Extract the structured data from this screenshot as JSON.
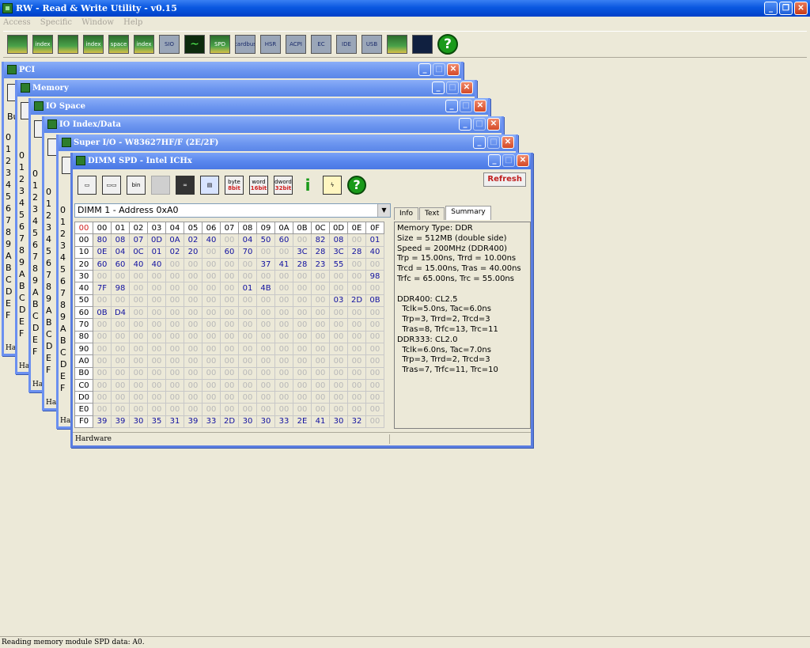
{
  "app": {
    "title": "RW - Read & Write Utility - v0.15"
  },
  "menu": [
    "Access",
    "Specific",
    "Window",
    "Help"
  ],
  "toolbar": [
    {
      "name": "pci-icon",
      "label": ""
    },
    {
      "name": "index-icon",
      "label": "index"
    },
    {
      "name": "memory-icon",
      "label": ""
    },
    {
      "name": "index-space-icon",
      "label": "index"
    },
    {
      "name": "io-space-icon",
      "label": "space"
    },
    {
      "name": "io-index-icon",
      "label": "index"
    },
    {
      "name": "sio-icon",
      "label": "SIO"
    },
    {
      "name": "waveform-icon",
      "label": "~"
    },
    {
      "name": "spd-icon",
      "label": "SPD"
    },
    {
      "name": "cardbus-icon",
      "label": "cardbus"
    },
    {
      "name": "hsr-icon",
      "label": "HSR"
    },
    {
      "name": "acpi-icon",
      "label": "ACPI"
    },
    {
      "name": "ec-icon",
      "label": "EC"
    },
    {
      "name": "ide-icon",
      "label": "IDE"
    },
    {
      "name": "usb-icon",
      "label": "USB"
    },
    {
      "name": "smbus-icon",
      "label": ""
    },
    {
      "name": "command-icon",
      "label": ""
    }
  ],
  "windows": [
    {
      "title": "PCI",
      "row_label": "Bu"
    },
    {
      "title": "Memory"
    },
    {
      "title": "IO Space"
    },
    {
      "title": "IO Index/Data"
    },
    {
      "title": "Super I/O - W83627HF/F (2E/2F)"
    }
  ],
  "back_row_labels": [
    "0",
    "1",
    "2",
    "3",
    "4",
    "5",
    "6",
    "7",
    "8",
    "9",
    "A",
    "B",
    "C",
    "D",
    "E",
    "F"
  ],
  "back_status": "Har",
  "dimm": {
    "title": "DIMM SPD - Intel ICHx",
    "refresh_label": "Refresh",
    "toolbar": {
      "byte": {
        "top": "byte",
        "bottom": "8bit"
      },
      "word": {
        "top": "word",
        "bottom": "16bit"
      },
      "dword": {
        "top": "dword",
        "bottom": "32bit"
      },
      "bin": "bin"
    },
    "select_value": "DIMM 1 - Address 0xA0",
    "tabs": [
      "Info",
      "Text",
      "Summary"
    ],
    "active_tab": "Summary",
    "corner": "00",
    "col_headers": [
      "00",
      "01",
      "02",
      "03",
      "04",
      "05",
      "06",
      "07",
      "08",
      "09",
      "0A",
      "0B",
      "0C",
      "0D",
      "0E",
      "0F"
    ],
    "rows": [
      {
        "addr": "00",
        "cells": [
          "80",
          "08",
          "07",
          "0D",
          "0A",
          "02",
          "40",
          "00",
          "04",
          "50",
          "60",
          "00",
          "82",
          "08",
          "00",
          "01"
        ]
      },
      {
        "addr": "10",
        "cells": [
          "0E",
          "04",
          "0C",
          "01",
          "02",
          "20",
          "00",
          "60",
          "70",
          "00",
          "00",
          "3C",
          "28",
          "3C",
          "28",
          "40"
        ]
      },
      {
        "addr": "20",
        "cells": [
          "60",
          "60",
          "40",
          "40",
          "00",
          "00",
          "00",
          "00",
          "00",
          "37",
          "41",
          "28",
          "23",
          "55",
          "00",
          "00"
        ]
      },
      {
        "addr": "30",
        "cells": [
          "00",
          "00",
          "00",
          "00",
          "00",
          "00",
          "00",
          "00",
          "00",
          "00",
          "00",
          "00",
          "00",
          "00",
          "00",
          "98"
        ]
      },
      {
        "addr": "40",
        "cells": [
          "7F",
          "98",
          "00",
          "00",
          "00",
          "00",
          "00",
          "00",
          "01",
          "4B",
          "00",
          "00",
          "00",
          "00",
          "00",
          "00"
        ]
      },
      {
        "addr": "50",
        "cells": [
          "00",
          "00",
          "00",
          "00",
          "00",
          "00",
          "00",
          "00",
          "00",
          "00",
          "00",
          "00",
          "00",
          "03",
          "2D",
          "0B"
        ]
      },
      {
        "addr": "60",
        "cells": [
          "0B",
          "D4",
          "00",
          "00",
          "00",
          "00",
          "00",
          "00",
          "00",
          "00",
          "00",
          "00",
          "00",
          "00",
          "00",
          "00"
        ]
      },
      {
        "addr": "70",
        "cells": [
          "00",
          "00",
          "00",
          "00",
          "00",
          "00",
          "00",
          "00",
          "00",
          "00",
          "00",
          "00",
          "00",
          "00",
          "00",
          "00"
        ]
      },
      {
        "addr": "80",
        "cells": [
          "00",
          "00",
          "00",
          "00",
          "00",
          "00",
          "00",
          "00",
          "00",
          "00",
          "00",
          "00",
          "00",
          "00",
          "00",
          "00"
        ]
      },
      {
        "addr": "90",
        "cells": [
          "00",
          "00",
          "00",
          "00",
          "00",
          "00",
          "00",
          "00",
          "00",
          "00",
          "00",
          "00",
          "00",
          "00",
          "00",
          "00"
        ]
      },
      {
        "addr": "A0",
        "cells": [
          "00",
          "00",
          "00",
          "00",
          "00",
          "00",
          "00",
          "00",
          "00",
          "00",
          "00",
          "00",
          "00",
          "00",
          "00",
          "00"
        ]
      },
      {
        "addr": "B0",
        "cells": [
          "00",
          "00",
          "00",
          "00",
          "00",
          "00",
          "00",
          "00",
          "00",
          "00",
          "00",
          "00",
          "00",
          "00",
          "00",
          "00"
        ]
      },
      {
        "addr": "C0",
        "cells": [
          "00",
          "00",
          "00",
          "00",
          "00",
          "00",
          "00",
          "00",
          "00",
          "00",
          "00",
          "00",
          "00",
          "00",
          "00",
          "00"
        ]
      },
      {
        "addr": "D0",
        "cells": [
          "00",
          "00",
          "00",
          "00",
          "00",
          "00",
          "00",
          "00",
          "00",
          "00",
          "00",
          "00",
          "00",
          "00",
          "00",
          "00"
        ]
      },
      {
        "addr": "E0",
        "cells": [
          "00",
          "00",
          "00",
          "00",
          "00",
          "00",
          "00",
          "00",
          "00",
          "00",
          "00",
          "00",
          "00",
          "00",
          "00",
          "00"
        ]
      },
      {
        "addr": "F0",
        "cells": [
          "39",
          "39",
          "30",
          "35",
          "31",
          "39",
          "33",
          "2D",
          "30",
          "30",
          "33",
          "2E",
          "41",
          "30",
          "32",
          "00"
        ]
      }
    ],
    "summary": "Memory Type: DDR\nSize = 512MB (double side)\nSpeed = 200MHz (DDR400)\nTrp = 15.00ns, Trrd = 10.00ns\nTrcd = 15.00ns, Tras = 40.00ns\nTrfc = 65.00ns, Trc = 55.00ns\n\nDDR400: CL2.5\n  Tclk=5.0ns, Tac=6.0ns\n  Trp=3, Trrd=2, Trcd=3\n  Tras=8, Trfc=13, Trc=11\nDDR333: CL2.0\n  Tclk=6.0ns, Tac=7.0ns\n  Trp=3, Trrd=2, Trcd=3\n  Tras=7, Trfc=11, Trc=10",
    "status": "Hardware"
  },
  "statusbar": "Reading memory module SPD data: A0."
}
